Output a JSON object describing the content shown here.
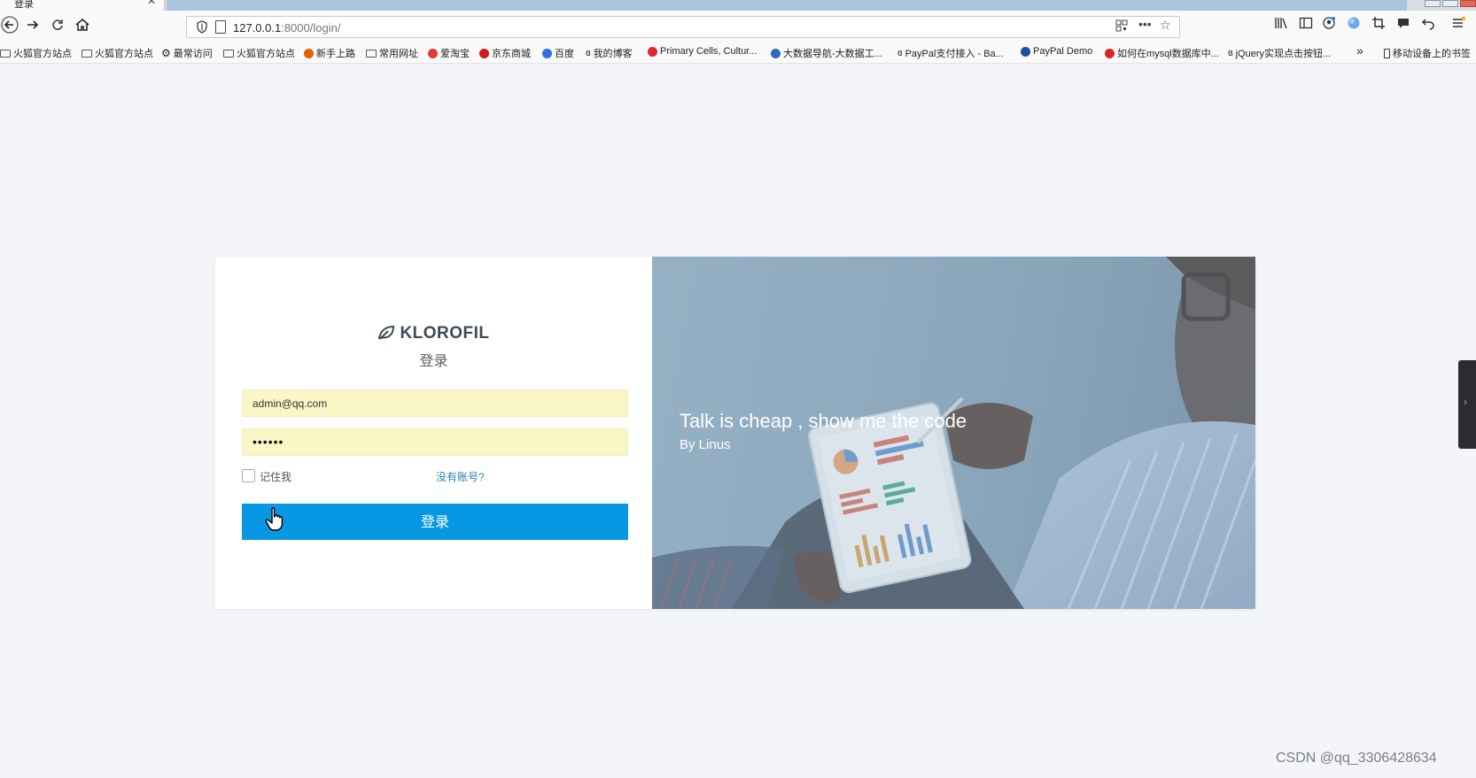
{
  "browser": {
    "tab_title": "登录",
    "tab_close": "✕",
    "url_host": "127.0.0.1",
    "url_path": ":8000/login/",
    "bookmarks": [
      {
        "label": "火狐官方站点",
        "icon": "folder-icon"
      },
      {
        "label": "火狐官方站点",
        "icon": "folder-icon"
      },
      {
        "label": "最常访问",
        "icon": "gear-icon"
      },
      {
        "label": "火狐官方站点",
        "icon": "folder-icon"
      },
      {
        "label": "新手上路",
        "icon": "firefox-icon"
      },
      {
        "label": "常用网址",
        "icon": "folder-icon"
      },
      {
        "label": "爱淘宝",
        "icon": "taobao-icon"
      },
      {
        "label": "京东商城",
        "icon": "jd-icon"
      },
      {
        "label": "百度",
        "icon": "baidu-icon"
      },
      {
        "label": "我的博客",
        "icon": "blog-icon"
      },
      {
        "label": "Primary Cells, Cultur...",
        "icon": "red-circle-icon"
      },
      {
        "label": "大数据导航-大数据工...",
        "icon": "bigdata-icon"
      },
      {
        "label": "PayPal支付接入 - Ba...",
        "icon": "link-icon"
      },
      {
        "label": "PayPal Demo",
        "icon": "paypal-icon"
      },
      {
        "label": "如何在mysql数据库中...",
        "icon": "csdn-icon"
      },
      {
        "label": "jQuery实现点击按钮...",
        "icon": "link-icon"
      }
    ],
    "overflow_chevron": "»",
    "mobile_bookmarks": "移动设备上的书签"
  },
  "login": {
    "brand": "KLOROFIL",
    "subtitle": "登录",
    "email_value": "admin@qq.com",
    "password_value": "••••••",
    "remember_label": "记住我",
    "register_link": "没有账号?",
    "submit_label": "登录"
  },
  "hero": {
    "quote": "Talk is cheap , show me the code",
    "author": "By Linus"
  },
  "side_tab_chevron": "›",
  "watermark": "CSDN @qq_3306428634",
  "colors": {
    "accent": "#0898e3",
    "autofill": "#fbf6c6",
    "link": "#2c7fb7",
    "page_bg": "#f3f5f8"
  }
}
